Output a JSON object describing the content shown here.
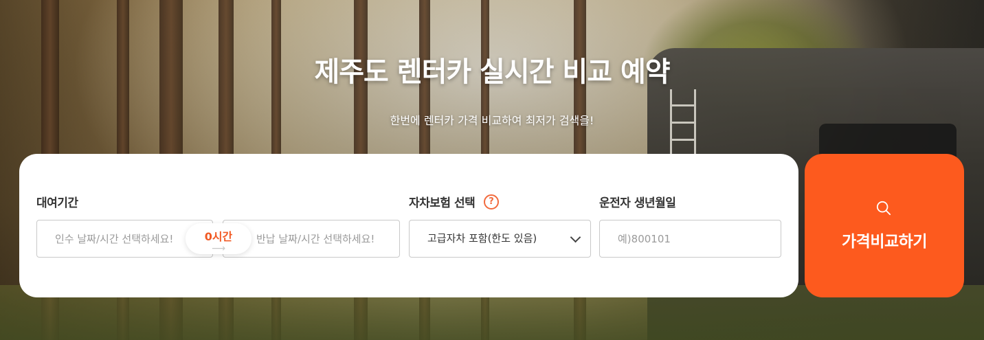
{
  "hero": {
    "title": "제주도 렌터카 실시간 비교 예약",
    "subtitle": "한번에 렌터카 가격 비교하여 최저가 검색을!"
  },
  "form": {
    "rental_period_label": "대여기간",
    "pickup_placeholder": "인수 날짜/시간 선택하세요!",
    "return_placeholder": "반납 날짜/시간 선택하세요!",
    "duration": "0시간",
    "duration_arrow": "⟶",
    "insurance_label": "자차보험 선택",
    "insurance_help": "?",
    "insurance_selected": "고급자차 포함(한도 있음)",
    "birth_label": "운전자 생년월일",
    "birth_placeholder": "예)800101"
  },
  "compare_button": {
    "label": "가격비교하기",
    "icon": "search-icon"
  },
  "colors": {
    "accent": "#fd5a1e",
    "duration_text": "#f15a24",
    "help_icon": "#f26a3d"
  }
}
